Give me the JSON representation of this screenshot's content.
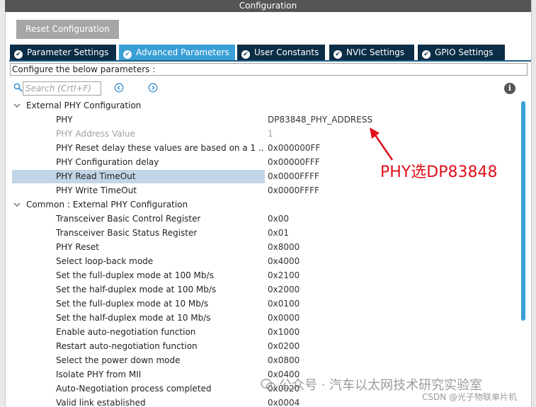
{
  "window": {
    "title": "Configuration"
  },
  "toolbar": {
    "reset_label": "Reset Configuration"
  },
  "tabs": [
    {
      "label": "Parameter Settings"
    },
    {
      "label": "Advanced Parameters"
    },
    {
      "label": "User Constants"
    },
    {
      "label": "NVIC Settings"
    },
    {
      "label": "GPIO Settings"
    }
  ],
  "describe_text": "Configure the below parameters :",
  "search": {
    "placeholder": "Search (Crtl+F)"
  },
  "groups": [
    {
      "label": "External PHY Configuration",
      "params": [
        {
          "label": "PHY",
          "value": "DP83848_PHY_ADDRESS"
        },
        {
          "label": "PHY Address Value",
          "value": "1"
        },
        {
          "label": "PHY Reset delay these values are based on a 1 ...",
          "value": "0x000000FF"
        },
        {
          "label": "PHY Configuration delay",
          "value": "0x00000FFF"
        },
        {
          "label": "PHY Read TimeOut",
          "value": "0x0000FFFF"
        },
        {
          "label": "PHY Write TimeOut",
          "value": "0x0000FFFF"
        }
      ]
    },
    {
      "label": "Common : External PHY Configuration",
      "params": [
        {
          "label": "Transceiver Basic Control Register",
          "value": "0x00"
        },
        {
          "label": "Transceiver Basic Status Register",
          "value": "0x01"
        },
        {
          "label": "PHY Reset",
          "value": "0x8000"
        },
        {
          "label": "Select loop-back mode",
          "value": "0x4000"
        },
        {
          "label": "Set the full-duplex mode at 100 Mb/s",
          "value": "0x2100"
        },
        {
          "label": "Set the half-duplex mode at 100 Mb/s",
          "value": "0x2000"
        },
        {
          "label": "Set the full-duplex mode at 10 Mb/s",
          "value": "0x0100"
        },
        {
          "label": "Set the half-duplex mode at 10 Mb/s",
          "value": "0x0000"
        },
        {
          "label": "Enable auto-negotiation function",
          "value": "0x1000"
        },
        {
          "label": "Restart auto-negotiation function",
          "value": "0x0200"
        },
        {
          "label": "Select the power down mode",
          "value": "0x0800"
        },
        {
          "label": "Isolate PHY from MII",
          "value": "0x0400"
        },
        {
          "label": "Auto-Negotiation process completed",
          "value": "0x0020"
        },
        {
          "label": "Valid link established",
          "value": "0x0004"
        }
      ]
    }
  ],
  "annotation": "PHY选DP83848",
  "watermark": "公众号 · 汽车以太网技术研究实验室",
  "csdn_credit": "CSDN @光子物联单片机",
  "colors": {
    "title_bar": "#555555",
    "tab_dark": "#0b2d47",
    "tab_active": "#3a9fd6",
    "selection": "#c2d5e6",
    "annotation": "#e0101a"
  }
}
